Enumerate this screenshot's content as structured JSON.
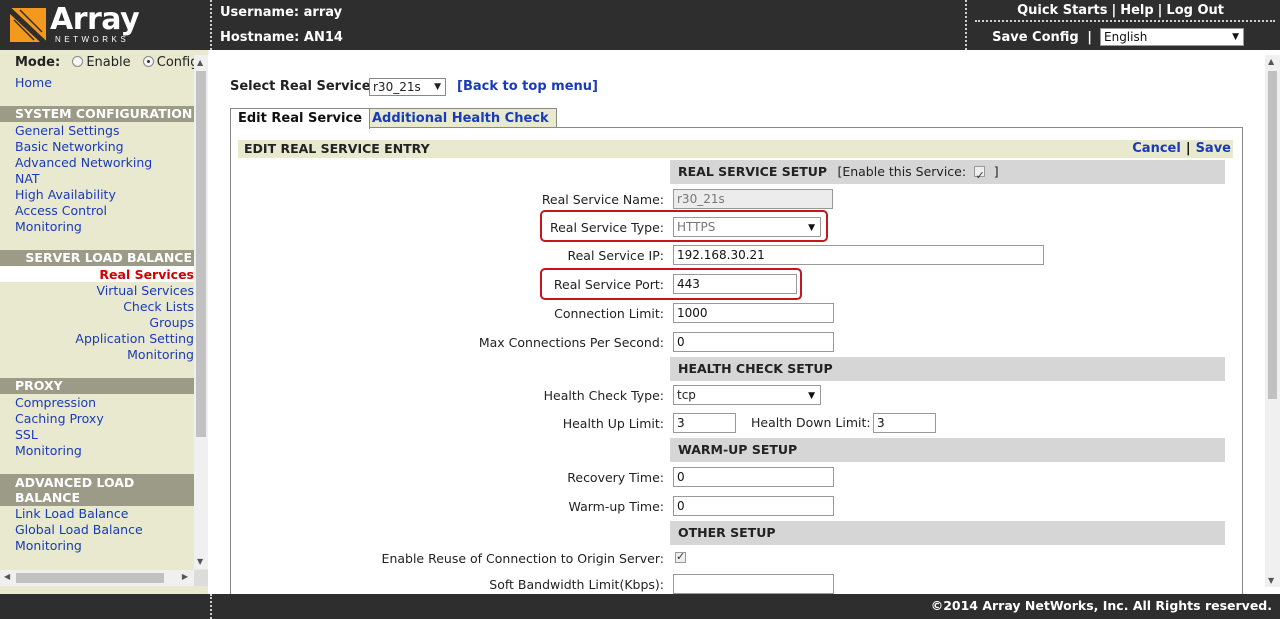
{
  "header": {
    "logo_word": "Array",
    "logo_sub": "NETWORKS",
    "username_label": "Username: array",
    "hostname_label": "Hostname: AN14",
    "links": [
      "Quick Starts",
      "Help",
      "Log Out"
    ],
    "save_config": "Save Config",
    "save_sep": "|",
    "language": "English"
  },
  "sidebar": {
    "mode_label": "Mode:",
    "mode_enable": "Enable",
    "mode_config": "Config",
    "home": "Home",
    "system_config": {
      "title": "SYSTEM CONFIGURATION",
      "items": [
        "General Settings",
        "Basic Networking",
        "Advanced Networking",
        "NAT",
        "High Availability",
        "Access Control",
        "Monitoring"
      ]
    },
    "slb": {
      "title": "SERVER LOAD BALANCE",
      "items": [
        "Real Services",
        "Virtual Services",
        "Check Lists",
        "Groups",
        "Application Setting",
        "Monitoring"
      ]
    },
    "proxy": {
      "title": "PROXY",
      "items": [
        "Compression",
        "Caching Proxy",
        "SSL",
        "Monitoring"
      ]
    },
    "alb": {
      "title": "ADVANCED LOAD BALANCE",
      "items": [
        "Link Load Balance",
        "Global Load Balance",
        "Monitoring"
      ]
    }
  },
  "main": {
    "select_label": "Select Real Service:",
    "select_value": "r30_21s",
    "back_link": "[Back to top menu]",
    "tabs": [
      {
        "label": "Edit Real Service",
        "active": true
      },
      {
        "label": "Additional Health Check",
        "active": false
      }
    ],
    "entry_title": "EDIT REAL SERVICE ENTRY",
    "cancel": "Cancel",
    "save": "Save",
    "sections": {
      "setup": "REAL SERVICE SETUP",
      "enable_prefix": "[Enable this Service:",
      "enable_suffix": "]",
      "health": "HEALTH CHECK SETUP",
      "warmup": "WARM-UP SETUP",
      "other": "OTHER SETUP"
    },
    "fields": {
      "name_label": "Real Service Name:",
      "name_value": "r30_21s",
      "type_label": "Real Service Type:",
      "type_value": "HTTPS",
      "ip_label": "Real Service IP:",
      "ip_value": "192.168.30.21",
      "port_label": "Real Service Port:",
      "port_value": "443",
      "conn_label": "Connection Limit:",
      "conn_value": "1000",
      "maxcps_label": "Max Connections Per Second:",
      "maxcps_value": "0",
      "hctype_label": "Health Check Type:",
      "hctype_value": "tcp",
      "hup_label": "Health Up Limit:",
      "hup_value": "3",
      "hdown_label": "Health Down Limit:",
      "hdown_value": "3",
      "recovery_label": "Recovery Time:",
      "recovery_value": "0",
      "warmup_label": "Warm-up Time:",
      "warmup_value": "0",
      "reuse_label": "Enable Reuse of Connection to Origin Server:",
      "softbw_label": "Soft Bandwidth Limit(Kbps):",
      "softbw_value": ""
    }
  },
  "footer": {
    "copyright": "©2014 Array NetWorks, Inc. All Rights reserved."
  },
  "colors": {
    "header_bg": "#2e2e2e",
    "sidebar_bg": "#e9e9cf",
    "section_bg": "#d6d6d6",
    "link": "#1a3bb8",
    "active_item": "#d10000",
    "logo_orange": "#f39a1e",
    "highlight": "#c4161c"
  }
}
